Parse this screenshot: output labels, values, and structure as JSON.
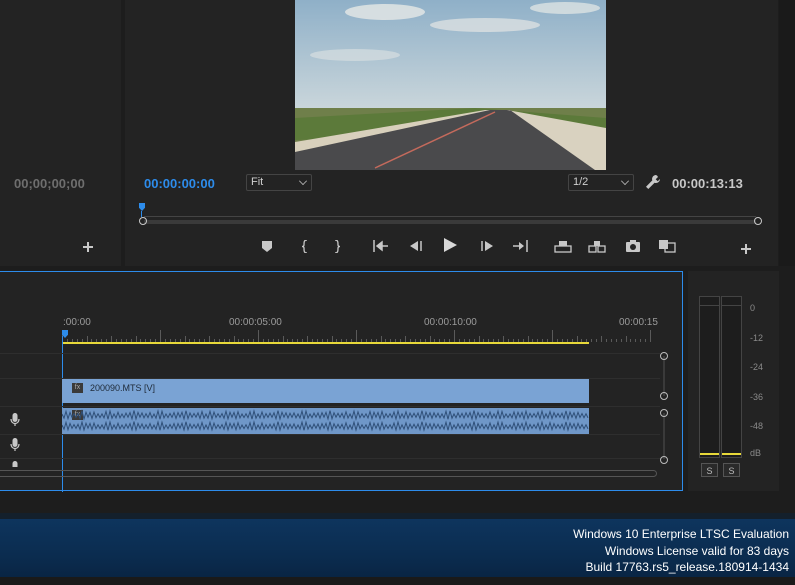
{
  "source_monitor": {
    "timecode": "00;00;00;00"
  },
  "program_monitor": {
    "timecode_current": "00:00:00:00",
    "zoom_select": "Fit",
    "resolution_select": "1/2",
    "timecode_duration": "00:00:13:13"
  },
  "timeline": {
    "ruler_labels": [
      ":00:00",
      "00:00:05:00",
      "00:00:10:00",
      "00:00:15"
    ],
    "video_clip_label": "200090.MTS [V]",
    "work_area_color": "#e8d93a",
    "clip_color": "#7aa3d4"
  },
  "audio_meter": {
    "scale": [
      "0",
      "-12",
      "-24",
      "-36",
      "-48",
      "dB"
    ],
    "solo_buttons": [
      "S",
      "S"
    ]
  },
  "watermark": {
    "line1": "Windows 10 Enterprise LTSC Evaluation",
    "line2": "Windows License valid for 83 days",
    "line3": "Build 17763.rs5_release.180914-1434"
  },
  "colors": {
    "accent_blue": "#2d8ceb",
    "panel_bg": "#232323",
    "taskbar_bg": "#0c2d4d"
  }
}
